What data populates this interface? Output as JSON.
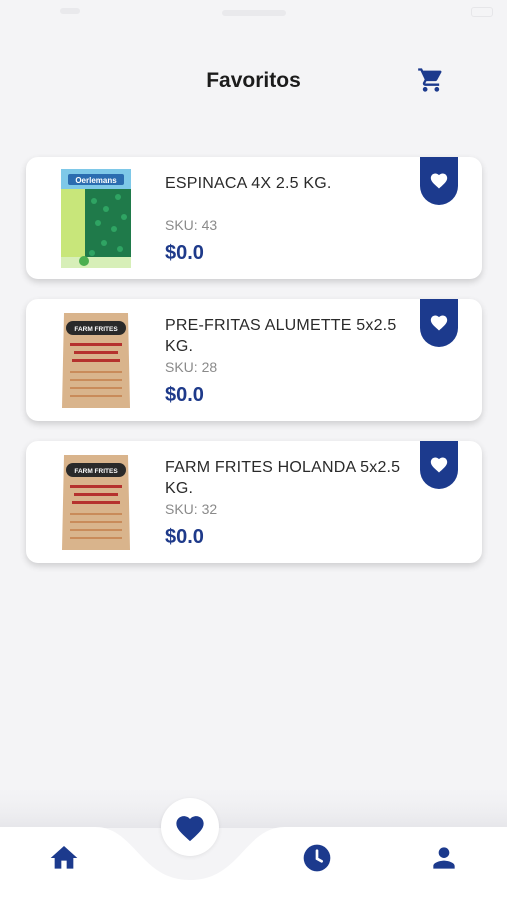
{
  "header": {
    "title": "Favoritos"
  },
  "products": [
    {
      "name": "ESPINACA 4X 2.5 KG.",
      "sku": "SKU: 43",
      "price": "$0.0",
      "image": "spinach-bag"
    },
    {
      "name": "PRE-FRITAS ALUMETTE 5x2.5 KG.",
      "sku": "SKU: 28",
      "price": "$0.0",
      "image": "fries-bag",
      "brand": "FARM FRITES"
    },
    {
      "name": "FARM FRITES HOLANDA 5x2.5 KG.",
      "sku": "SKU: 32",
      "price": "$0.0",
      "image": "fries-bag",
      "brand": "FARM FRITES"
    }
  ],
  "spinach_brand": "Oerlemans",
  "nav": {
    "items": [
      "home-icon",
      "heart-icon",
      "clock-icon",
      "user-icon"
    ],
    "active": "heart-icon"
  },
  "colors": {
    "accent": "#1c3a8d",
    "price": "#1e3a8a",
    "background": "#f4f4f6"
  }
}
